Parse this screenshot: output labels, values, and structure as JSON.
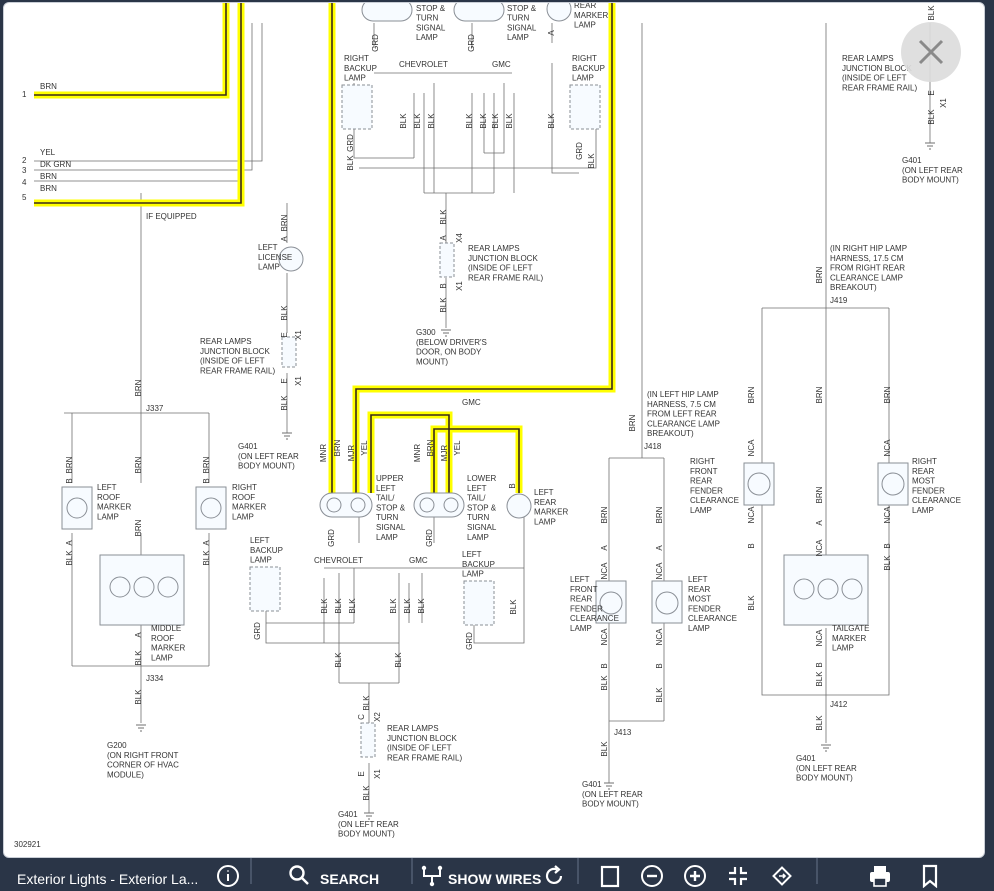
{
  "diagram_id": "302921",
  "toolbar": {
    "title": "Exterior Lights - Exterior La...",
    "search_label": "SEARCH",
    "show_wires_label": "SHOW WIRES"
  },
  "colors": {
    "highlight": "#ffff00",
    "wire_dark": "#3a2a1a",
    "toolbar_bg": "#2a3547"
  },
  "left_connector": {
    "pins": [
      {
        "num": "1",
        "wire": "BRN"
      },
      {
        "num": "2",
        "wire": "YEL"
      },
      {
        "num": "3",
        "wire": "DK GRN"
      },
      {
        "num": "4",
        "wire": "BRN"
      },
      {
        "num": "5",
        "wire": "BRN"
      }
    ],
    "if_equipped": "IF EQUIPPED"
  },
  "labels": {
    "chevrolet": "CHEVROLET",
    "gmc": "GMC",
    "brn": "BRN",
    "blk": "BLK",
    "grd": "GRD",
    "yel": "YEL",
    "mnr": "MNR",
    "mjr": "MJR",
    "a": "A",
    "b": "B",
    "c": "C",
    "e": "E",
    "x1": "X1",
    "x2": "X2",
    "x4": "X4",
    "nca": "NCA"
  },
  "components": {
    "top_tail_stop_l": "TAIL/\nSTOP &\nTURN\nSIGNAL\nLAMP",
    "top_tail_stop_r": "TAIL/\nSTOP &\nTURN\nSIGNAL\nLAMP",
    "top_rear_marker": "REAR\nMARKER\nLAMP",
    "right_backup_l": "RIGHT\nBACKUP\nLAMP",
    "right_backup_r": "RIGHT\nBACKUP\nLAMP",
    "rl_jb_x4": "REAR LAMPS\nJUNCTION BLOCK\n(INSIDE OF LEFT\nREAR FRAME RAIL)",
    "g300": "G300\n(BELOW DRIVER'S\nDOOR, ON BODY\nMOUNT)",
    "left_license": "LEFT\nLICENSE\nLAMP",
    "rl_jb_x1": "REAR LAMPS\nJUNCTION BLOCK\n(INSIDE OF LEFT\nREAR FRAME RAIL)",
    "g401_lic": "G401\n(ON LEFT REAR\nBODY MOUNT)",
    "j337": "J337",
    "left_roof": "LEFT\nROOF\nMARKER\nLAMP",
    "right_roof": "RIGHT\nROOF\nMARKER\nLAMP",
    "middle_roof": "MIDDLE\nROOF\nMARKER\nLAMP",
    "j334": "J334",
    "g200": "G200\n(ON RIGHT FRONT\nCORNER OF HVAC\nMODULE)",
    "upper_left_tail": "UPPER\nLEFT\nTAIL/\nSTOP &\nTURN\nSIGNAL\nLAMP",
    "lower_left_tail": "LOWER\nLEFT\nTAIL/\nSTOP &\nTURN\nSIGNAL\nLAMP",
    "left_rear_marker": "LEFT\nREAR\nMARKER\nLAMP",
    "left_backup_l": "LEFT\nBACKUP\nLAMP",
    "left_backup_r": "LEFT\nBACKUP\nLAMP",
    "rl_jb_x2": "REAR LAMPS\nJUNCTION BLOCK\n(INSIDE OF LEFT\nREAR FRAME RAIL)",
    "g401_bottom": "G401\n(ON LEFT REAR\nBODY MOUNT)",
    "left_hip": "(IN LEFT HIP LAMP\nHARNESS, 7.5 CM\nFROM LEFT REAR\nCLEARANCE LAMP\nBREAKOUT)",
    "j418": "J418",
    "left_front_clear": "LEFT\nFRONT\nREAR\nFENDER\nCLEARANCE\nLAMP",
    "left_rear_clear": "LEFT\nREAR\nMOST\nFENDER\nCLEARANCE\nLAMP",
    "j413": "J413",
    "g401_j413": "G401\n(ON LEFT REAR\nBODY MOUNT)",
    "rl_jb_right": "REAR LAMPS\nJUNCTION BLOCK\n(INSIDE OF LEFT\nREAR FRAME RAIL)",
    "g401_right_top": "G401\n(ON LEFT REAR\nBODY MOUNT)",
    "right_hip": "(IN RIGHT HIP LAMP\nHARNESS, 17.5 CM\nFROM RIGHT REAR\nCLEARANCE LAMP\nBREAKOUT)",
    "j419": "J419",
    "right_front_clear": "RIGHT\nFRONT\nREAR\nFENDER\nCLEARANCE\nLAMP",
    "right_rear_clear": "RIGHT\nREAR\nMOST\nFENDER\nCLEARANCE\nLAMP",
    "tailgate": "TAILGATE\nMARKER\nLAMP",
    "j412": "J412",
    "g401_j412": "G401\n(ON LEFT REAR\nBODY MOUNT)"
  }
}
